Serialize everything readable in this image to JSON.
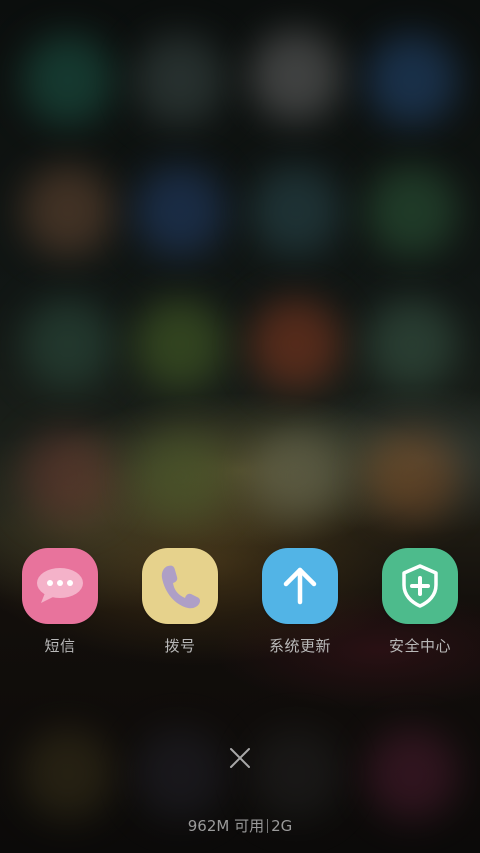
{
  "shortcuts": [
    {
      "label": "短信",
      "icon": "message-bubble-icon",
      "color": "#e8739c"
    },
    {
      "label": "拨号",
      "icon": "phone-icon",
      "color": "#e6d28c"
    },
    {
      "label": "系统更新",
      "icon": "arrow-up-icon",
      "color": "#52b4e6"
    },
    {
      "label": "安全中心",
      "icon": "shield-plus-icon",
      "color": "#4dbb8c"
    }
  ],
  "close_button": {
    "icon": "close-icon"
  },
  "memory_status": {
    "available": "962M 可用",
    "total": "2G"
  }
}
